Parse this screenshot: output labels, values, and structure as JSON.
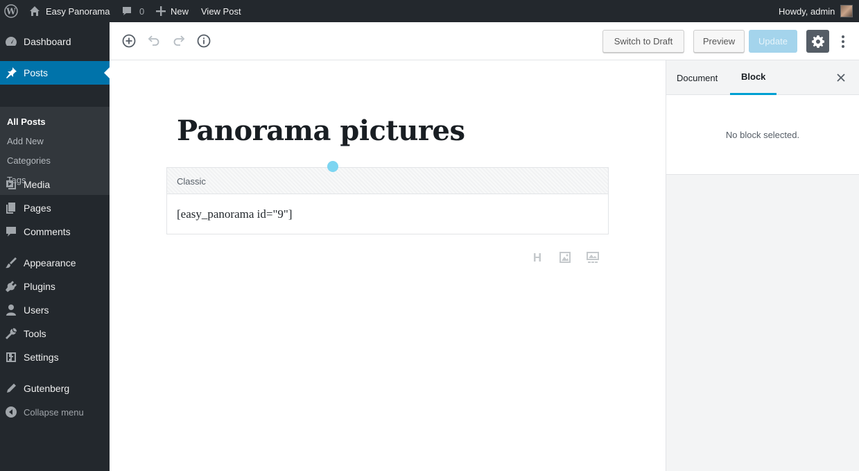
{
  "adminbar": {
    "site_name": "Easy Panorama",
    "comments_count": "0",
    "new_label": "New",
    "view_post_label": "View Post",
    "greeting": "Howdy, admin"
  },
  "sidebar": {
    "items": [
      {
        "label": "Dashboard",
        "icon": "dashboard-icon"
      },
      {
        "label": "Posts",
        "icon": "pushpin-icon",
        "current": true
      },
      {
        "label": "Media",
        "icon": "media-icon"
      },
      {
        "label": "Pages",
        "icon": "pages-icon"
      },
      {
        "label": "Comments",
        "icon": "comments-icon"
      },
      {
        "label": "Appearance",
        "icon": "paintbrush-icon"
      },
      {
        "label": "Plugins",
        "icon": "plugins-icon"
      },
      {
        "label": "Users",
        "icon": "users-icon"
      },
      {
        "label": "Tools",
        "icon": "wrench-icon"
      },
      {
        "label": "Settings",
        "icon": "settings-icon"
      },
      {
        "label": "Gutenberg",
        "icon": "edit-icon"
      }
    ],
    "submenu": [
      "All Posts",
      "Add New",
      "Categories",
      "Tags"
    ],
    "collapse_label": "Collapse menu"
  },
  "toolbar": {
    "switch_to_draft": "Switch to Draft",
    "preview": "Preview",
    "update": "Update"
  },
  "post": {
    "title": "Panorama pictures",
    "block_label": "Classic",
    "shortcode": "[easy_panorama id=\"9\"]"
  },
  "panel": {
    "tabs": [
      "Document",
      "Block"
    ],
    "active_tab": "Block",
    "empty_message": "No block selected."
  },
  "colors": {
    "admin_bg": "#23282d",
    "accent": "#0073aa",
    "update_button": "#a4d4ec",
    "tab_underline": "#00a0d2"
  }
}
